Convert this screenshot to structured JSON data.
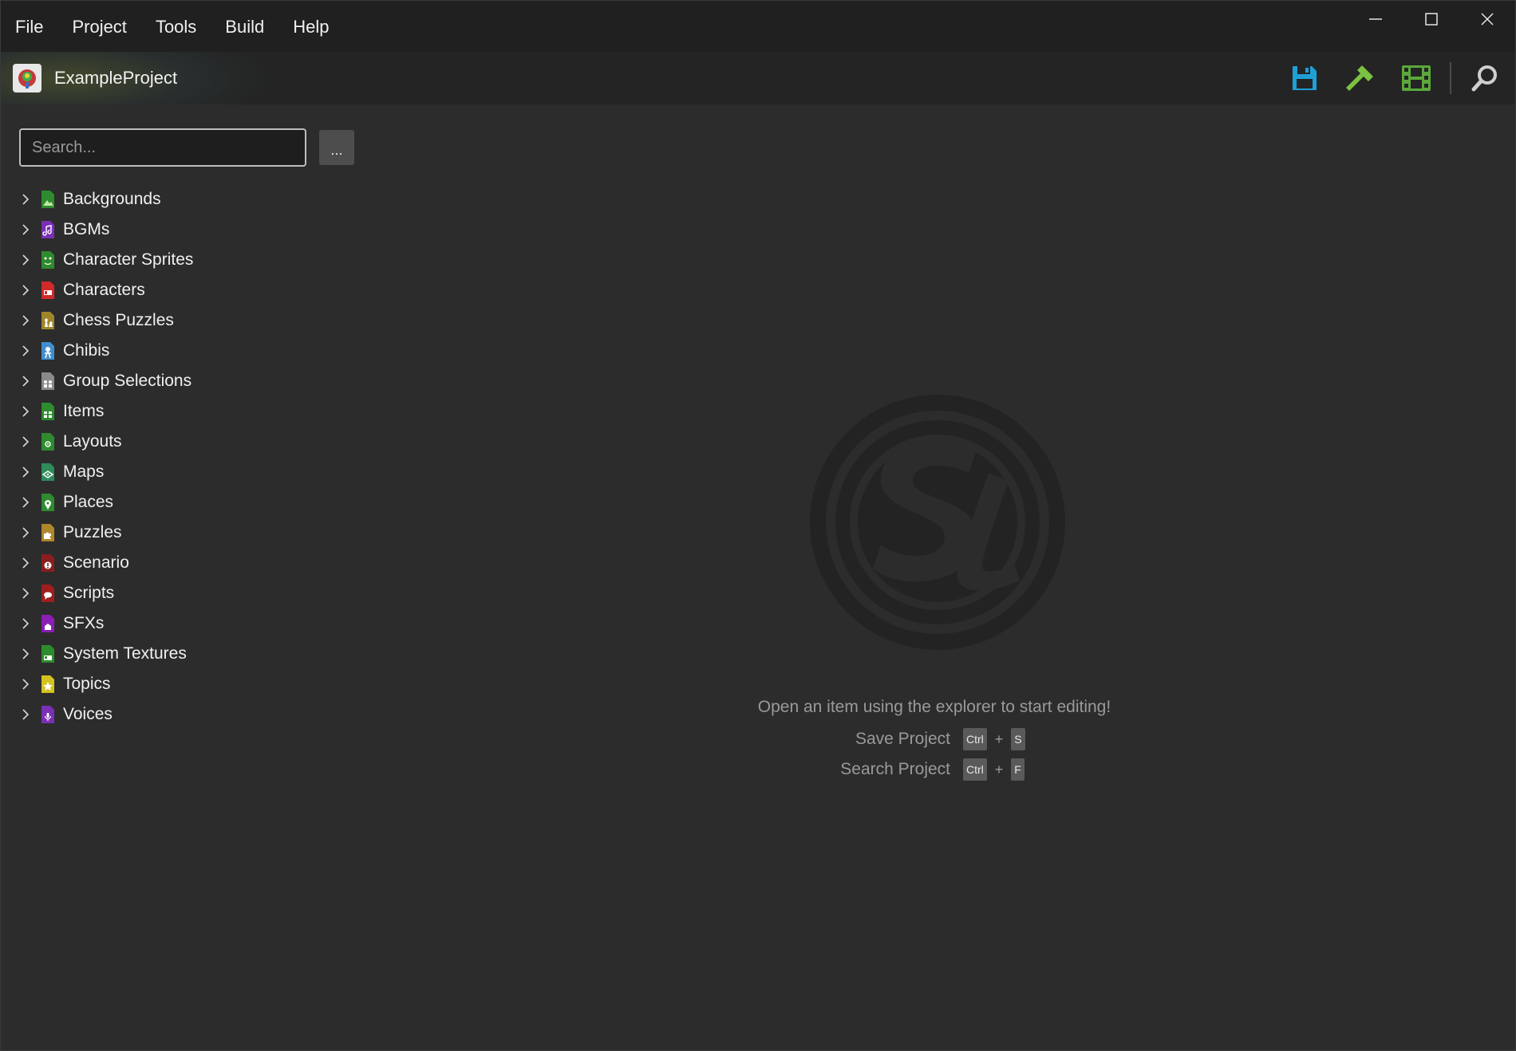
{
  "menu": [
    {
      "label": "File"
    },
    {
      "label": "Project"
    },
    {
      "label": "Tools"
    },
    {
      "label": "Build"
    },
    {
      "label": "Help"
    }
  ],
  "project": {
    "name": "ExampleProject"
  },
  "toolbar": {
    "save_icon": "save-icon",
    "build_icon": "hammer-icon",
    "run_icon": "film-icon",
    "search_icon": "search-icon",
    "colors": {
      "save": "#1ea0d6",
      "build": "#7cc242",
      "run": "#5aa83a",
      "search": "#cfcfcf"
    }
  },
  "sidebar": {
    "search_placeholder": "Search...",
    "more_label": "...",
    "items": [
      {
        "label": "Backgrounds",
        "icon": "image-icon",
        "color": "#2e8b2e"
      },
      {
        "label": "BGMs",
        "icon": "music-icon",
        "color": "#7a2fb5"
      },
      {
        "label": "Character Sprites",
        "icon": "sprite-icon",
        "color": "#2e8b2e"
      },
      {
        "label": "Characters",
        "icon": "id-card-icon",
        "color": "#d02a2a"
      },
      {
        "label": "Chess Puzzles",
        "icon": "chess-icon",
        "color": "#a0862a"
      },
      {
        "label": "Chibis",
        "icon": "chibi-icon",
        "color": "#3f8fd0"
      },
      {
        "label": "Group Selections",
        "icon": "group-icon",
        "color": "#8a8a8a"
      },
      {
        "label": "Items",
        "icon": "gift-icon",
        "color": "#2e8b2e"
      },
      {
        "label": "Layouts",
        "icon": "layout-icon",
        "color": "#2e8b2e"
      },
      {
        "label": "Maps",
        "icon": "map-icon",
        "color": "#2e8b5a"
      },
      {
        "label": "Places",
        "icon": "pin-icon",
        "color": "#2e8b2e"
      },
      {
        "label": "Puzzles",
        "icon": "puzzle-icon",
        "color": "#b0862a"
      },
      {
        "label": "Scenario",
        "icon": "scenario-icon",
        "color": "#8a1e1e"
      },
      {
        "label": "Scripts",
        "icon": "speech-icon",
        "color": "#a01e1e"
      },
      {
        "label": "SFXs",
        "icon": "sfx-icon",
        "color": "#8a1eb5"
      },
      {
        "label": "System Textures",
        "icon": "texture-icon",
        "color": "#2e8b2e"
      },
      {
        "label": "Topics",
        "icon": "star-icon",
        "color": "#d4c21e"
      },
      {
        "label": "Voices",
        "icon": "mic-icon",
        "color": "#7a2fb5"
      }
    ]
  },
  "empty_state": {
    "message": "Open an item using the explorer to start editing!",
    "shortcuts": [
      {
        "label": "Save Project",
        "mod": "Ctrl",
        "plus": "+",
        "key": "S"
      },
      {
        "label": "Search Project",
        "mod": "Ctrl",
        "plus": "+",
        "key": "F"
      }
    ]
  }
}
